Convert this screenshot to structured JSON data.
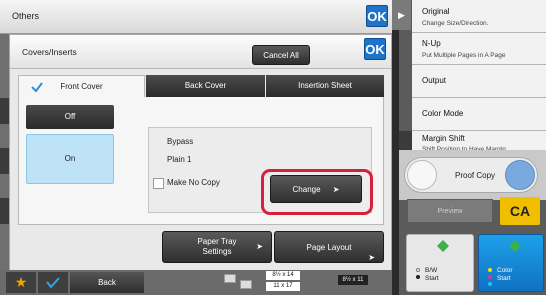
{
  "header": {
    "title": "Others",
    "ok_label": "OK"
  },
  "dialog": {
    "title": "Covers/Inserts",
    "ok_label": "OK",
    "cancel_label": "Cancel All",
    "tabs": [
      "Front Cover",
      "Back Cover",
      "Insertion Sheet"
    ],
    "off_label": "Off",
    "on_label": "On",
    "paper_source": "Bypass",
    "paper_type": "Plain 1",
    "make_no_copy": "Make No Copy",
    "change_label": "Change",
    "paper_tray_label_1": "Paper Tray",
    "paper_tray_label_2": "Settings",
    "page_layout_label": "Page Layout"
  },
  "bottom_bar": {
    "back_label": "Back",
    "tray_sizes": [
      "8½ x 14",
      "11 x 17",
      "8½ x 11"
    ]
  },
  "right_menu": {
    "items": [
      {
        "label": "Original",
        "sub": "Change Size/Direction."
      },
      {
        "label": "N-Up",
        "sub": "Put Multiple Pages in A Page"
      },
      {
        "label": "Output",
        "sub": ""
      },
      {
        "label": "Color Mode",
        "sub": ""
      },
      {
        "label": "Margin Shift",
        "sub": "Shift Position to Have Margin"
      }
    ],
    "proof_copy": "Proof Copy",
    "preview": "Preview",
    "ca": "CA",
    "bw_label": "B/W",
    "bw_start": "Start",
    "color_label": "Color",
    "color_start": "Start"
  },
  "colors": {
    "accent": "#1f73c9",
    "highlight": "#d6203c",
    "ca": "#f0c000",
    "selected": "#bfe3f6"
  }
}
